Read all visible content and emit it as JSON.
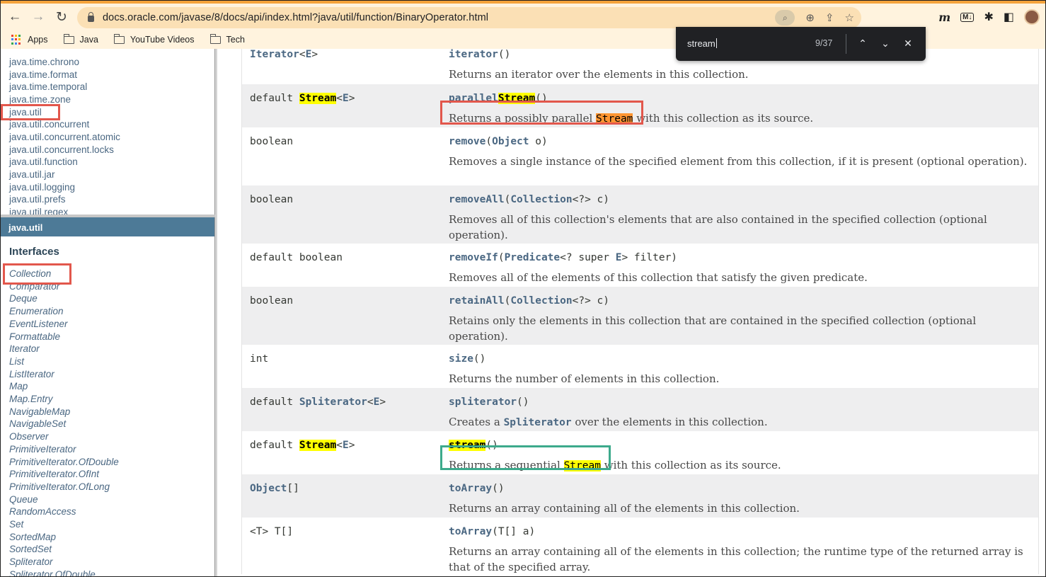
{
  "browser": {
    "url": "docs.oracle.com/javase/8/docs/api/index.html?java/util/function/BinaryOperator.html",
    "back_icon": "←",
    "forward_icon": "→",
    "reload_icon": "↻",
    "bookmarks": [
      {
        "label": "Apps",
        "icon": "apps-grid-icon"
      },
      {
        "label": "Java",
        "icon": "folder-icon"
      },
      {
        "label": "YouTube Videos",
        "icon": "folder-icon"
      },
      {
        "label": "Tech",
        "icon": "folder-icon"
      }
    ],
    "colors": {
      "accent": "#f5a33b",
      "toolbar": "#fff3de",
      "omnibox": "#fbe0b5"
    }
  },
  "find_bar": {
    "query": "stream",
    "count": "9/37",
    "prev_icon": "⌃",
    "next_icon": "⌄",
    "close_icon": "✕"
  },
  "package_list": [
    "java.time.chrono",
    "java.time.format",
    "java.time.temporal",
    "java.time.zone",
    "java.util",
    "java.util.concurrent",
    "java.util.concurrent.atomic",
    "java.util.concurrent.locks",
    "java.util.function",
    "java.util.jar",
    "java.util.logging",
    "java.util.prefs",
    "java.util.regex"
  ],
  "package_frame": {
    "title": "java.util",
    "interfaces_heading": "Interfaces",
    "interfaces": [
      "Collection",
      "Comparator",
      "Deque",
      "Enumeration",
      "EventListener",
      "Formattable",
      "Iterator",
      "List",
      "ListIterator",
      "Map",
      "Map.Entry",
      "NavigableMap",
      "NavigableSet",
      "Observer",
      "PrimitiveIterator",
      "PrimitiveIterator.OfDouble",
      "PrimitiveIterator.OfInt",
      "PrimitiveIterator.OfLong",
      "Queue",
      "RandomAccess",
      "Set",
      "SortedMap",
      "SortedSet",
      "Spliterator",
      "Spliterator.OfDouble"
    ]
  },
  "methods": [
    {
      "type": "Iterator<E>",
      "method": "iterator()",
      "desc": "Returns an iterator over the elements in this collection."
    },
    {
      "type": "default Stream<E>",
      "method": "parallelStream()",
      "desc_a": "Returns a possibly parallel ",
      "desc_hl": "Stream",
      "desc_b": " with this collection as its source."
    },
    {
      "type": "boolean",
      "method_name": "remove",
      "method_args_a": "(",
      "method_type": "Object",
      "method_args_b": " o)",
      "desc": "Removes a single instance of the specified element from this collection, if it is present (optional operation)."
    },
    {
      "type": "boolean",
      "method_name": "removeAll",
      "method_args_a": "(",
      "method_type": "Collection",
      "method_args_b": "<?> c)",
      "desc": "Removes all of this collection's elements that are also contained in the specified collection (optional operation)."
    },
    {
      "type": "default boolean",
      "method_name": "removeIf",
      "method_args_a": "(",
      "method_type": "Predicate",
      "method_args_b": "<? super ",
      "method_type2": "E",
      "method_args_c": "> filter)",
      "desc": "Removes all of the elements of this collection that satisfy the given predicate."
    },
    {
      "type": "boolean",
      "method_name": "retainAll",
      "method_args_a": "(",
      "method_type": "Collection",
      "method_args_b": "<?> c)",
      "desc": "Retains only the elements in this collection that are contained in the specified collection (optional operation)."
    },
    {
      "type": "int",
      "method_name": "size",
      "method_args_a": "()",
      "desc": "Returns the number of elements in this collection."
    },
    {
      "type_a": "default ",
      "type_link": "Spliterator",
      "type_b": "<",
      "type_e": "E",
      "type_c": ">",
      "method_name": "spliterator",
      "method_args_a": "()",
      "desc_a": "Creates a ",
      "desc_code": "Spliterator",
      "desc_b": " over the elements in this collection."
    },
    {
      "type": "default Stream<E>",
      "method_name": "stream",
      "method_args_a": "()",
      "desc_a": "Returns a sequential ",
      "desc_hl": "Stream",
      "desc_b": " with this collection as its source."
    },
    {
      "type_link": "Object",
      "type_b": "[]",
      "method_name": "toArray",
      "method_args_a": "()",
      "desc": "Returns an array containing all of the elements in this collection."
    },
    {
      "type": "<T> T[]",
      "method_name": "toArray",
      "method_args_a": "(T[] a)",
      "desc": "Returns an array containing all of the elements in this collection; the runtime type of the returned array is that of the specified array."
    }
  ],
  "type_parts": {
    "default": "default ",
    "stream": "Stream",
    "lt": "<",
    "e": "E",
    "gt": ">",
    "parallel": "parallel",
    "stream_word": "Stream",
    "parens": "()",
    "iterator_type": "Iterator",
    "iterator_method": "iterator"
  },
  "annotation_colors": {
    "red": "#e2574c",
    "green": "#3daa8c",
    "find_current": "#ff9632",
    "find_match": "#ffff00"
  }
}
